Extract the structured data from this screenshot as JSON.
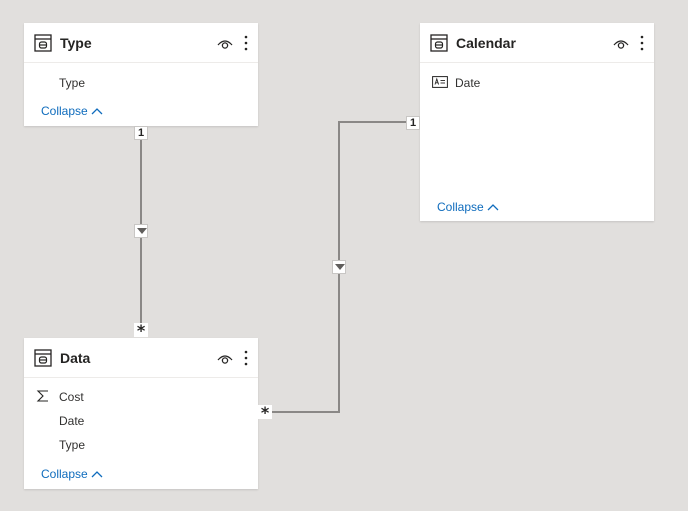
{
  "tables": {
    "type": {
      "title": "Type",
      "fields": [
        {
          "label": "Type",
          "icon": "none"
        }
      ],
      "collapse": "Collapse"
    },
    "calendar": {
      "title": "Calendar",
      "fields": [
        {
          "label": "Date",
          "icon": "text-field-icon"
        }
      ],
      "collapse": "Collapse"
    },
    "data": {
      "title": "Data",
      "fields": [
        {
          "label": "Cost",
          "icon": "sigma-icon"
        },
        {
          "label": "Date",
          "icon": "none"
        },
        {
          "label": "Type",
          "icon": "none"
        }
      ],
      "collapse": "Collapse"
    }
  },
  "relationships": [
    {
      "from": "Type",
      "to": "Data",
      "from_card": "1",
      "to_card": "*"
    },
    {
      "from": "Calendar",
      "to": "Data",
      "from_card": "1",
      "to_card": "*"
    }
  ],
  "colors": {
    "canvas": "#e1dfdd",
    "card": "#ffffff",
    "line": "#8a8886",
    "link": "#0f6cbd",
    "text": "#252423"
  }
}
